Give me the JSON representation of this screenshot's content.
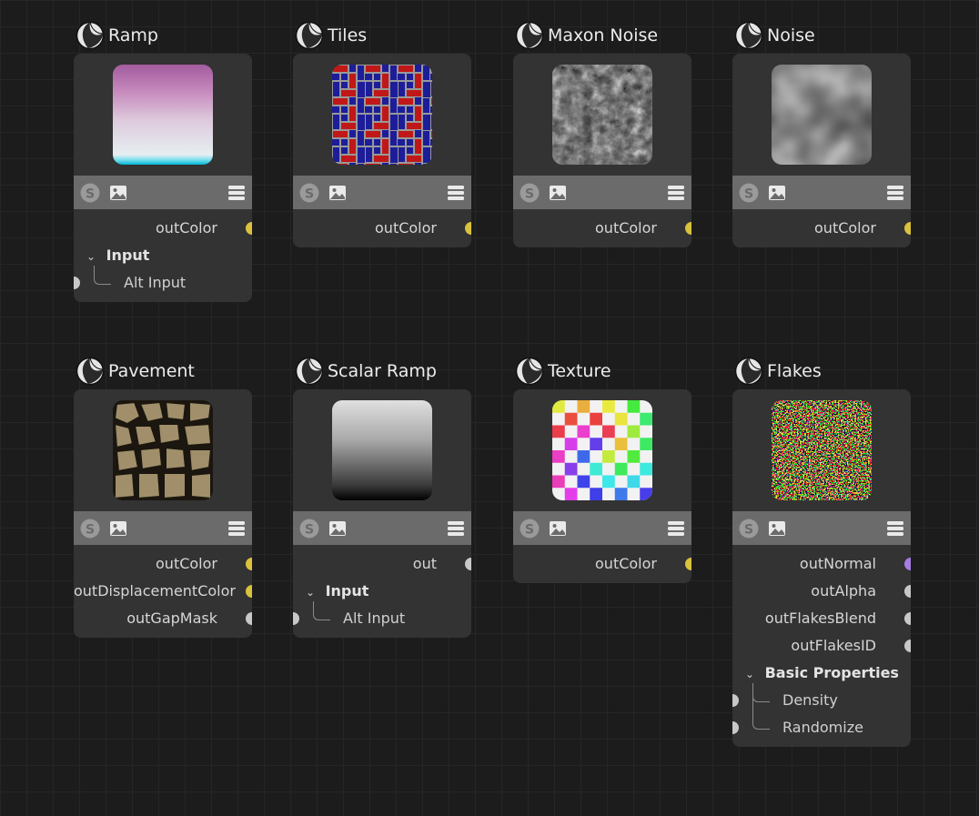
{
  "colors": {
    "port_color": "#d9c23c",
    "port_default": "#c8c8c8",
    "port_normal": "#a57ee0"
  },
  "nodes": {
    "ramp": {
      "title": "Ramp",
      "outputs": [
        "outColor"
      ],
      "group": "Input",
      "inputs": [
        "Alt Input"
      ]
    },
    "tiles": {
      "title": "Tiles",
      "outputs": [
        "outColor"
      ]
    },
    "maxon_noise": {
      "title": "Maxon Noise",
      "outputs": [
        "outColor"
      ]
    },
    "noise": {
      "title": "Noise",
      "outputs": [
        "outColor"
      ]
    },
    "pavement": {
      "title": "Pavement",
      "outputs": [
        "outColor",
        "outDisplacementColor",
        "outGapMask"
      ]
    },
    "scalar_ramp": {
      "title": "Scalar Ramp",
      "outputs": [
        "out"
      ],
      "group": "Input",
      "inputs": [
        "Alt Input"
      ]
    },
    "texture": {
      "title": "Texture",
      "outputs": [
        "outColor"
      ]
    },
    "flakes": {
      "title": "Flakes",
      "outputs": [
        "outNormal",
        "outAlpha",
        "outFlakesBlend",
        "outFlakesID"
      ],
      "group": "Basic Properties",
      "inputs": [
        "Density",
        "Randomize"
      ]
    }
  },
  "icons": {
    "node_icon": "material-sphere-icon",
    "toolbar": [
      "shader-s-icon",
      "image-icon",
      "menu-icon"
    ]
  }
}
